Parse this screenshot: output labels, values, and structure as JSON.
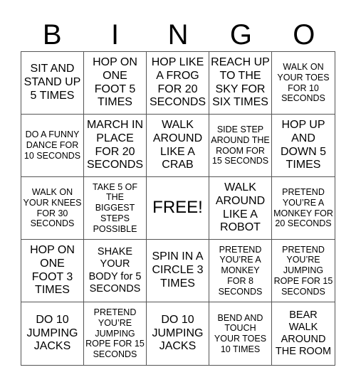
{
  "header": [
    "B",
    "I",
    "N",
    "G",
    "O"
  ],
  "cells": [
    "SIT AND STAND UP 5 TIMES",
    "HOP ON ONE FOOT 5 TIMES",
    "HOP LIKE A FROG FOR 20 SECONDS",
    "REACH UP TO THE SKY FOR SIX TIMES",
    "WALK ON YOUR TOES FOR 10 SECONDS",
    "DO A FUNNY DANCE FOR 10 SECONDS",
    "MARCH IN PLACE FOR 20 SECONDS",
    "WALK AROUND LIKE A CRAB",
    "SIDE STEP AROUND THE ROOM FOR 15 SECONDS",
    "HOP UP AND DOWN 5 TIMES",
    "WALK ON YOUR KNEES FOR 30 SECONDS",
    "TAKE 5 OF THE BIGGEST STEPS POSSIBLE",
    "FREE!",
    "WALK AROUND LIKE A ROBOT",
    "PRETEND YOU’RE A MONKEY FOR 20 SECONDS",
    "HOP ON ONE FOOT 3 TIMES",
    "SHAKE YOUR BODY for 5 SECONDS",
    "SPIN IN A CIRCLE 3 TIMES",
    "PRETEND YOU’RE A MONKEY FOR 8 SECONDS",
    "PRETEND YOU’RE JUMPING ROPE FOR 15 SECONDS",
    "DO 10 JUMPING JACKS",
    "PRETEND YOU’RE JUMPING ROPE FOR 15 SECONDS",
    "DO 10 JUMPING JACKS",
    "BEND AND TOUCH YOUR TOES 10 TIMES",
    "BEAR WALK AROUND THE ROOM"
  ]
}
